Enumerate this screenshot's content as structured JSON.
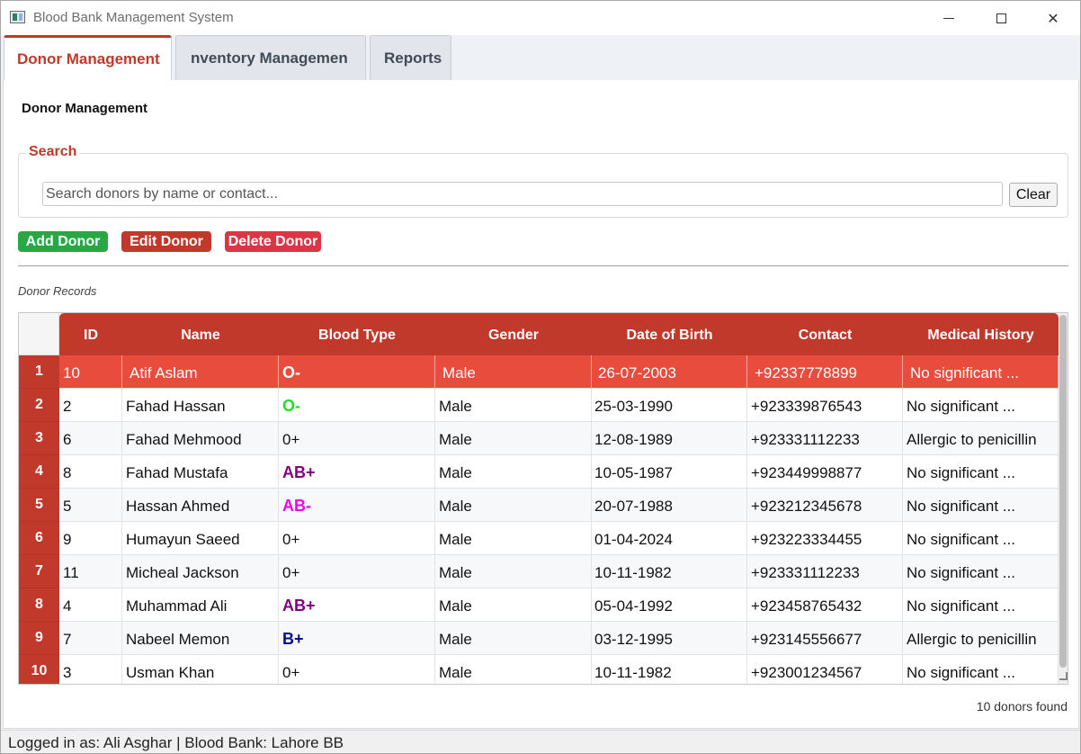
{
  "window": {
    "title": "Blood Bank Management System",
    "minimize_icon": "minimize-icon",
    "maximize_icon": "maximize-icon",
    "close_glyph": "✕"
  },
  "tabs": [
    {
      "label": "Donor Management",
      "active": true
    },
    {
      "label": "nventory Managemen",
      "active": false
    },
    {
      "label": "Reports",
      "active": false
    }
  ],
  "page": {
    "title": "Donor Management",
    "search": {
      "legend": "Search",
      "placeholder": "Search donors by name or contact...",
      "value": "",
      "clear_label": "Clear"
    },
    "actions": {
      "add_label": "Add Donor",
      "edit_label": "Edit Donor",
      "delete_label": "Delete Donor"
    },
    "records_label": "Donor Records",
    "count_text": "10 donors found"
  },
  "table": {
    "columns": [
      "ID",
      "Name",
      "Blood Type",
      "Gender",
      "Date of Birth",
      "Contact",
      "Medical History"
    ],
    "rows": [
      {
        "num": "1",
        "id": "10",
        "name": "Atif Aslam",
        "blood": "O-",
        "gender": "Male",
        "dob": "26-07-2003",
        "contact": "+92337778899",
        "history": "No significant ..."
      },
      {
        "num": "2",
        "id": "2",
        "name": "Fahad Hassan",
        "blood": "O-",
        "gender": "Male",
        "dob": "25-03-1990",
        "contact": "+923339876543",
        "history": "No significant ..."
      },
      {
        "num": "3",
        "id": "6",
        "name": "Fahad Mehmood",
        "blood": "0+",
        "gender": "Male",
        "dob": "12-08-1989",
        "contact": "+923331112233",
        "history": "Allergic to penicillin"
      },
      {
        "num": "4",
        "id": "8",
        "name": "Fahad Mustafa",
        "blood": "AB+",
        "gender": "Male",
        "dob": "10-05-1987",
        "contact": "+923449998877",
        "history": "No significant ..."
      },
      {
        "num": "5",
        "id": "5",
        "name": "Hassan Ahmed",
        "blood": "AB-",
        "gender": "Male",
        "dob": "20-07-1988",
        "contact": "+923212345678",
        "history": "No significant ..."
      },
      {
        "num": "6",
        "id": "9",
        "name": "Humayun Saeed",
        "blood": "0+",
        "gender": "Male",
        "dob": "01-04-2024",
        "contact": "+923223334455",
        "history": "No significant ..."
      },
      {
        "num": "7",
        "id": "11",
        "name": "Micheal Jackson",
        "blood": "0+",
        "gender": "Male",
        "dob": "10-11-1982",
        "contact": "+923331112233",
        "history": "No significant ..."
      },
      {
        "num": "8",
        "id": "4",
        "name": "Muhammad Ali",
        "blood": "AB+",
        "gender": "Male",
        "dob": "05-04-1992",
        "contact": "+923458765432",
        "history": "No significant ..."
      },
      {
        "num": "9",
        "id": "7",
        "name": "Nabeel Memon",
        "blood": "B+",
        "gender": "Male",
        "dob": "03-12-1995",
        "contact": "+923145556677",
        "history": "Allergic to penicillin"
      },
      {
        "num": "10",
        "id": "3",
        "name": "Usman Khan",
        "blood": "0+",
        "gender": "Male",
        "dob": "10-11-1982",
        "contact": "+923001234567",
        "history": "No significant ..."
      }
    ],
    "selected_row": 0,
    "blood_colors": {
      "O-": "#22dd22",
      "AB+": "#800080",
      "AB-": "#ee00ee",
      "B+": "#0a0a8a",
      "0+": "#111111"
    }
  },
  "status": {
    "text": "Logged in as: Ali Asghar | Blood Bank: Lahore BB"
  },
  "colors": {
    "accent": "#c0392b",
    "selected_row": "#e74c3c",
    "add": "#28a745",
    "delete": "#dc3545"
  }
}
